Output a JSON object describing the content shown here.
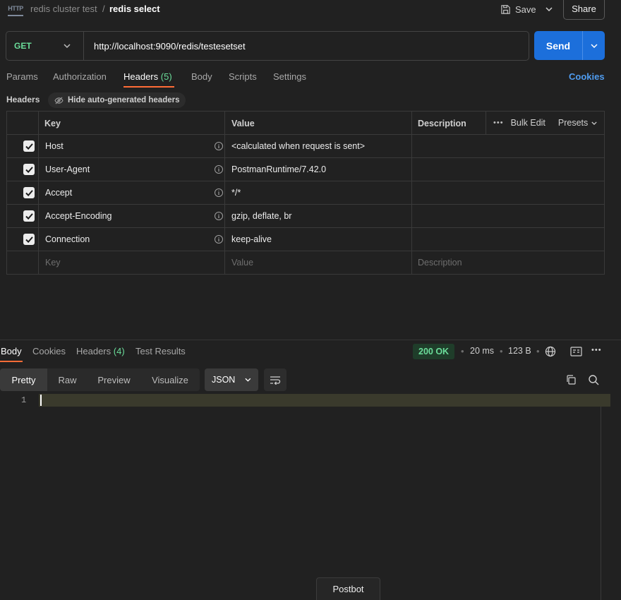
{
  "breadcrumb": {
    "collection": "redis cluster test",
    "separator": "/",
    "request": "redis select"
  },
  "header_actions": {
    "save_label": "Save",
    "share_label": "Share"
  },
  "request": {
    "method": "GET",
    "url": "http://localhost:9090/redis/testesetset",
    "send_label": "Send"
  },
  "request_tabs": [
    {
      "label": "Params"
    },
    {
      "label": "Authorization"
    },
    {
      "label": "Headers",
      "count": "(5)",
      "active": true
    },
    {
      "label": "Body"
    },
    {
      "label": "Scripts"
    },
    {
      "label": "Settings"
    }
  ],
  "cookies_link": "Cookies",
  "headers_section": {
    "title": "Headers",
    "hide_auto_label": "Hide auto-generated headers"
  },
  "headers_table": {
    "columns": {
      "key": "Key",
      "value": "Value",
      "description": "Description"
    },
    "bulk_edit": "Bulk Edit",
    "presets": "Presets",
    "rows": [
      {
        "key": "Host",
        "value": "<calculated when request is sent>",
        "checked": true
      },
      {
        "key": "User-Agent",
        "value": "PostmanRuntime/7.42.0",
        "checked": true
      },
      {
        "key": "Accept",
        "value": "*/*",
        "checked": true
      },
      {
        "key": "Accept-Encoding",
        "value": "gzip, deflate, br",
        "checked": true
      },
      {
        "key": "Connection",
        "value": "keep-alive",
        "checked": true
      }
    ],
    "placeholder": {
      "key": "Key",
      "value": "Value",
      "description": "Description"
    }
  },
  "response_tabs": [
    {
      "label": "Body",
      "active": true
    },
    {
      "label": "Cookies"
    },
    {
      "label": "Headers",
      "count": "(4)"
    },
    {
      "label": "Test Results"
    }
  ],
  "response_meta": {
    "status": "200 OK",
    "time": "20 ms",
    "size": "123 B"
  },
  "response_view": {
    "modes": [
      "Pretty",
      "Raw",
      "Preview",
      "Visualize"
    ],
    "active_mode": "Pretty",
    "format": "JSON",
    "line_number": "1"
  },
  "postbot_label": "Postbot",
  "colors": {
    "accent_orange": "#ff6c37",
    "send_blue": "#1c6fdb",
    "success_green": "#6bdd9a",
    "link_blue": "#4f9cf0"
  }
}
